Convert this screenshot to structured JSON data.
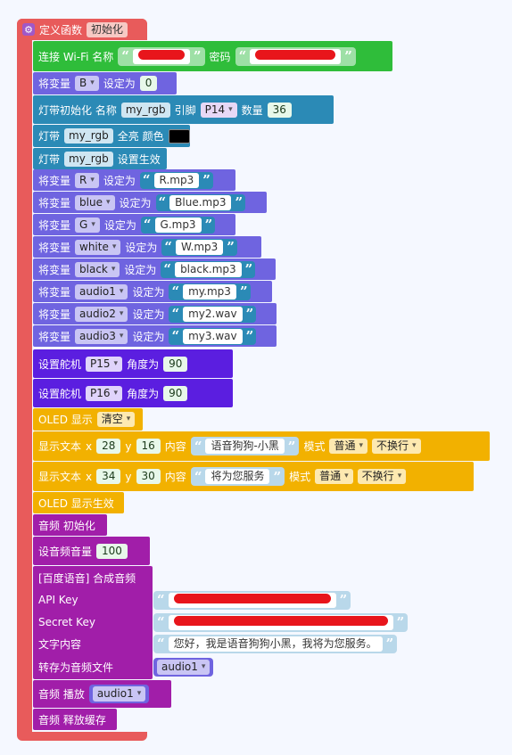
{
  "colors": {
    "procedure": "#e85b5b",
    "wifi": "#2fbd3a",
    "variable": "#6f64e0",
    "strip": "#2b8ab6",
    "servo": "#5b1ee0",
    "oled": "#f2b100",
    "audio": "#a11ea9"
  },
  "procedure": {
    "gear_icon": "gear-icon",
    "label": "定义函数",
    "name": "初始化"
  },
  "wifi": {
    "label": "连接 Wi-Fi 名称",
    "password_label": "密码",
    "ssid": "",
    "password": ""
  },
  "set_b": {
    "prefix": "将变量",
    "var": "B",
    "to": "设定为",
    "value": "0"
  },
  "strip_init": {
    "label": "灯带初始化 名称",
    "name": "my_rgb",
    "pin_label": "引脚",
    "pin": "P14",
    "count_label": "数量",
    "count": "36"
  },
  "strip_fill": {
    "prefix": "灯带",
    "name": "my_rgb",
    "label": "全亮 颜色",
    "color": "#000000"
  },
  "strip_show": {
    "prefix": "灯带",
    "name": "my_rgb",
    "label": "设置生效"
  },
  "var_assignments": [
    {
      "prefix": "将变量",
      "var": "R",
      "to": "设定为",
      "value": "R.mp3"
    },
    {
      "prefix": "将变量",
      "var": "blue",
      "to": "设定为",
      "value": "Blue.mp3"
    },
    {
      "prefix": "将变量",
      "var": "G",
      "to": "设定为",
      "value": "G.mp3"
    },
    {
      "prefix": "将变量",
      "var": "white",
      "to": "设定为",
      "value": "W.mp3"
    },
    {
      "prefix": "将变量",
      "var": "black",
      "to": "设定为",
      "value": "black.mp3"
    },
    {
      "prefix": "将变量",
      "var": "audio1",
      "to": "设定为",
      "value": "my.mp3"
    },
    {
      "prefix": "将变量",
      "var": "audio2",
      "to": "设定为",
      "value": "my2.wav"
    },
    {
      "prefix": "将变量",
      "var": "audio3",
      "to": "设定为",
      "value": "my3.wav"
    }
  ],
  "servos": [
    {
      "label": "设置舵机",
      "pin": "P15",
      "angle_label": "角度为",
      "angle": "90"
    },
    {
      "label": "设置舵机",
      "pin": "P16",
      "angle_label": "角度为",
      "angle": "90"
    }
  ],
  "oled_clear": {
    "label": "OLED 显示",
    "option": "清空"
  },
  "oled_texts": [
    {
      "label": "显示文本",
      "x_label": "x",
      "x": "28",
      "y_label": "y",
      "y": "16",
      "content_label": "内容",
      "content": "语音狗狗-小黑",
      "mode_label": "模式",
      "mode": "普通",
      "wrap": "不换行"
    },
    {
      "label": "显示文本",
      "x_label": "x",
      "x": "34",
      "y_label": "y",
      "y": "30",
      "content_label": "内容",
      "content": "将为您服务",
      "mode_label": "模式",
      "mode": "普通",
      "wrap": "不换行"
    }
  ],
  "oled_show": {
    "label": "OLED 显示生效"
  },
  "audio_init": {
    "label": "音频 初始化"
  },
  "audio_volume": {
    "label": "设音频音量",
    "value": "100"
  },
  "tts": {
    "title": "[百度语音] 合成音频",
    "api_key_label": "API Key",
    "secret_key_label": "Secret Key",
    "text_label": "文字内容",
    "text": "您好，我是语音狗狗小黑，我将为您服务。",
    "save_label": "转存为音频文件",
    "save_var": "audio1"
  },
  "audio_play": {
    "label": "音频 播放",
    "var": "audio1"
  },
  "audio_release": {
    "label": "音频 释放缓存"
  }
}
